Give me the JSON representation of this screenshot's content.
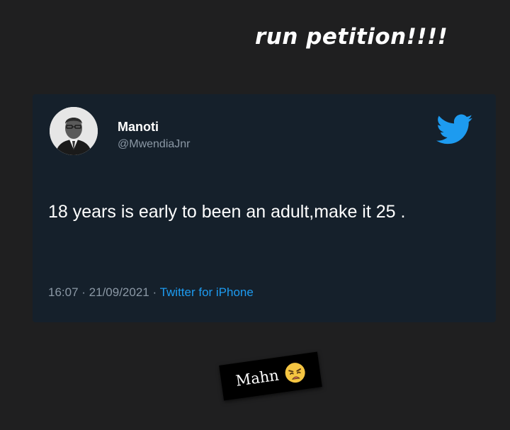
{
  "caption": "run petition!!!!",
  "tweet": {
    "author_name": "Manoti",
    "author_handle": "@MwendiaJnr",
    "text": "18 years is early to been an adult,make it 25 .",
    "time": "16:07",
    "date": "21/09/2021",
    "separator": " · ",
    "source": "Twitter for iPhone"
  },
  "sticker": {
    "text": "Mahn",
    "emoji": "weary-face-icon"
  },
  "colors": {
    "background": "#1f1f20",
    "card": "#15202b",
    "twitter_blue": "#1d9bf0",
    "muted": "#8b98a5"
  }
}
